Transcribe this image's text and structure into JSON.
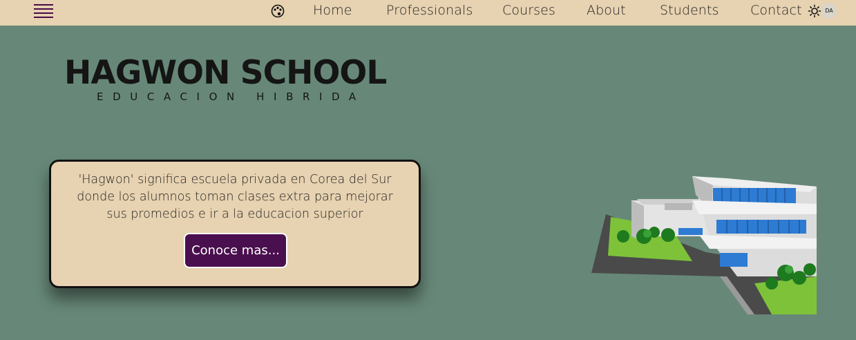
{
  "nav": {
    "links": [
      "Home",
      "Professionals",
      "Courses",
      "About",
      "Students",
      "Contact"
    ],
    "language_badge": "DA",
    "icons": {
      "menu": "hamburger-menu-icon",
      "theme_palette": "palette-icon",
      "theme_toggle": "sun-icon"
    }
  },
  "hero": {
    "title": "HAGWON SCHOOL",
    "subtitle": "EDUCACION HIBRIDA",
    "card_text": "'Hagwon' significa escuela privada en Corea del Sur donde los alumnos toman clases extra para mejorar sus promedios e ir a la educacion superior",
    "button_label": "Conoce mas..."
  },
  "colors": {
    "background": "#678878",
    "nav_background": "#e7d2b1",
    "card_background": "#e7d2b1",
    "button_background": "#4a0f4e",
    "accent": "#4a0a4a"
  }
}
